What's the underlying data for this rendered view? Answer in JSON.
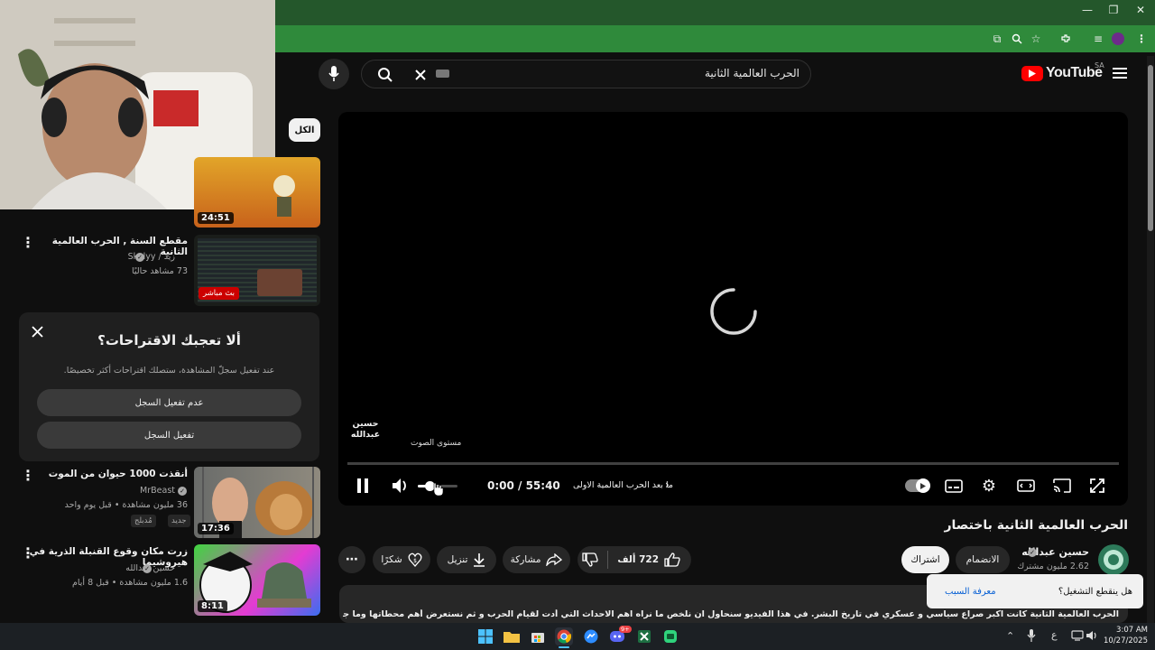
{
  "browser": {
    "window_controls": {
      "minimize": "—",
      "restore": "❐",
      "close": "✕"
    }
  },
  "youtube": {
    "logo_text": "YouTube",
    "region": "SA",
    "search": {
      "value": "الحرب العالمية الثانية"
    }
  },
  "sidebar": {
    "chip_all": "الكل",
    "items": [
      {
        "title": "",
        "duration": "24:51",
        "channel": "",
        "meta": ""
      },
      {
        "title": "مقطع السنة , الحرب العالمية الثانية",
        "channel": "زيد / Skelyy",
        "meta": "73 مشاهد حاليًا",
        "live_badge": "بث مباشر"
      },
      {
        "title": "أنقذت 1000 حيوان من الموت",
        "channel": "MrBeast",
        "meta": "36 مليون مشاهدة • قبل يوم واحد",
        "badge_new": "جديد",
        "badge_dub": "مُدبلج",
        "duration": "17:36"
      },
      {
        "title": "زرت مكان وقوع القنبلة الذرية في هيروشيما",
        "channel": "حسين عبدالله",
        "meta": "1.6 مليون مشاهدة • قبل 8 أيام",
        "duration": "8:11"
      }
    ],
    "suggest_card": {
      "title": "ألا تعجبك الاقتراحات؟",
      "desc": "عند تفعيل سجلّ المشاهدة، ستصلك اقتراحات أكثر تخصيصًا.",
      "btn_keep_off": "عدم تفعيل السجل",
      "btn_enable": "تفعيل السجل"
    }
  },
  "player": {
    "watermark": "حسين عبدالله",
    "volume_tooltip": "مستوى الصوت",
    "time": "0:00 / 55:40",
    "chapter": "ما بعد الحرب العالمية الاولى",
    "volume_level": 0.3
  },
  "video": {
    "title": "الحرب العالمية الثانية باختصار",
    "channel": "حسين عبدالله",
    "subs": "2.62 مليون مشترك",
    "join": "الانضمام",
    "subscribe": "اشتراك",
    "likes": "722 ألف",
    "share": "مشاركة",
    "download": "تنزيل",
    "thanks": "شكرًا",
    "description": "الحرب العالمية الثانية كانت اكبر صراع سياسي و عسكري في تاريخ البشر. في هذا الفيديو سنحاول ان نلخص ما نراه اهم الاحداث التي أدت لقيام الحرب و ثم نستعرض أهم محطاتها وما جرى خلالها من تطورات. ان كان هناك أي احداث"
  },
  "toast": {
    "question": "هل ينقطع التشغيل؟",
    "link": "معرفة السبب"
  },
  "taskbar": {
    "time": "3:07 AM",
    "date": "10/27/2025",
    "lang": "ع",
    "discord_badge": "9+"
  },
  "colors": {
    "chrome_dark": "#24572b",
    "chrome_toolbar": "#2f8a3b",
    "yt_red": "#ff0000",
    "live_red": "#cc0000",
    "toast_link": "#3ea6ff"
  }
}
